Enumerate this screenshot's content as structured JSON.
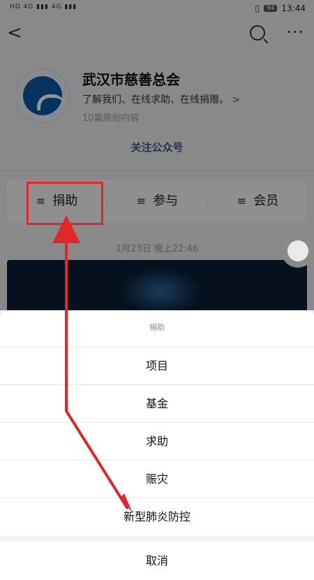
{
  "status_bar": {
    "left_text": "HD 4G ▮▮▮ 4G ▮▮▮",
    "battery": "94",
    "time": "13:44"
  },
  "nav": {
    "back_icon": "chevron-left-icon",
    "search_icon": "search-icon",
    "more_icon": "more-dots-icon"
  },
  "profile": {
    "name": "武汉市慈善总会",
    "intro": "了解我们、在线求助、在线捐赠。",
    "intro_chevron": ">",
    "count": "10篇原创内容",
    "follow": "关注公众号"
  },
  "menu": {
    "items": [
      {
        "label": "捐助"
      },
      {
        "label": "参与"
      },
      {
        "label": "会员"
      }
    ],
    "hamburger": "≡"
  },
  "feed": {
    "date": "1月23日 晚上22:46"
  },
  "sheet": {
    "title": "捐助",
    "options": [
      "项目",
      "基金",
      "求助",
      "赈灾",
      "新型肺炎防控"
    ],
    "cancel": "取消"
  },
  "colors": {
    "annotation": "#e02828",
    "link": "#3f5b8a"
  }
}
